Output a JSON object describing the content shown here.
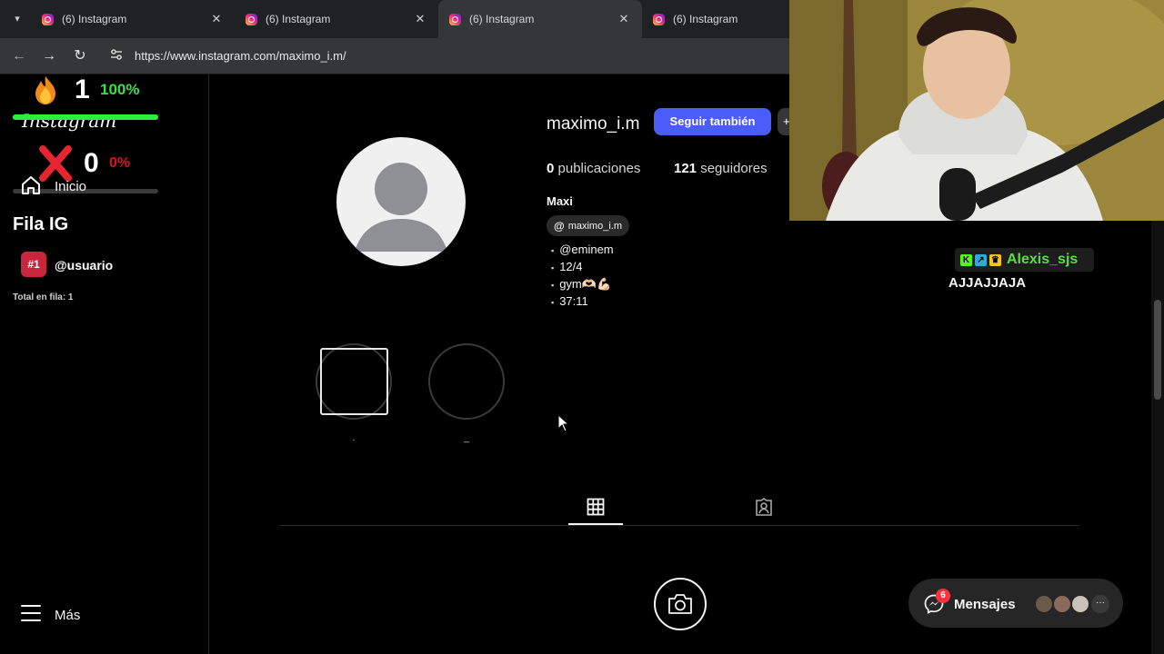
{
  "browser": {
    "tabs": [
      {
        "title": "(6) Instagram"
      },
      {
        "title": "(6) Instagram"
      },
      {
        "title": "(6) Instagram",
        "active": true
      },
      {
        "title": "(6) Instagram"
      }
    ],
    "close_glyph": "✕",
    "url": "https://www.instagram.com/maximo_i.m/"
  },
  "overlay": {
    "streak_count": "1",
    "streak_percent": "100%",
    "streak_progress": 1.0,
    "brand_script": "Instagram",
    "fail_count": "0",
    "fail_percent": "0%"
  },
  "sidebar": {
    "home_label": "Inicio",
    "more_label": "Más"
  },
  "queue": {
    "title": "Fila IG",
    "items": [
      {
        "rank": "#1",
        "user": "@usuario"
      }
    ],
    "total": "Total en fila: 1"
  },
  "profile": {
    "username": "maximo_i.m",
    "follow_label": "Seguir también",
    "follow_more": "+",
    "posts_count": "0",
    "posts_label": "publicaciones",
    "followers_count": "121",
    "followers_label": "seguidores",
    "display_name": "Maxi",
    "threads_handle": "maximo_i.m",
    "threads_glyph": "@",
    "bio_lines": [
      "@eminem",
      "12/4",
      "gym🫶🏻💪🏻",
      "37:11"
    ],
    "highlights": [
      {
        "label": "."
      },
      {
        "label": "_"
      }
    ]
  },
  "chat": {
    "user": "Alexis_sjs",
    "message": "AJJAJJAJA",
    "badges": [
      {
        "glyph": "K",
        "color": "#53fc18"
      },
      {
        "glyph": "↗",
        "color": "#2fa9e0"
      },
      {
        "glyph": "♛",
        "color": "#f5c518"
      }
    ]
  },
  "messages": {
    "label": "Mensajes",
    "unread": "6",
    "more_glyph": "···"
  },
  "colors": {
    "accent": "#4a5df9",
    "notification": "#ff3040",
    "chat_user": "#58e040",
    "streak_green": "#3ae04a",
    "fail_red": "#d4141a"
  }
}
